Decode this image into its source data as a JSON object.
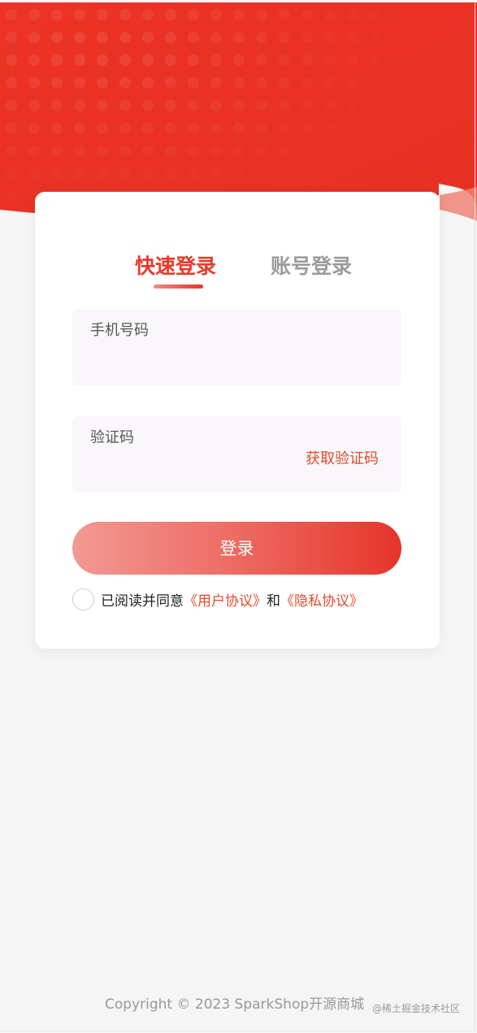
{
  "tabs": {
    "quick_login": "快速登录",
    "account_login": "账号登录"
  },
  "form": {
    "phone_label": "手机号码",
    "phone_value": "",
    "code_label": "验证码",
    "code_value": "",
    "get_code": "获取验证码",
    "submit": "登录"
  },
  "agreement": {
    "prefix": "已阅读并同意",
    "user_agreement": "《用户协议》",
    "and": "和",
    "privacy_agreement": "《隐私协议》",
    "checked": false
  },
  "footer": {
    "copyright": "Copyright © 2023 SparkShop开源商城",
    "watermark": "@稀土掘金技术社区"
  },
  "colors": {
    "brand_red": "#e8392b",
    "link_red": "#e44a2c",
    "button_gradient_start": "#f19994",
    "button_gradient_end": "#e6342a",
    "background": "#f5f5f5"
  }
}
